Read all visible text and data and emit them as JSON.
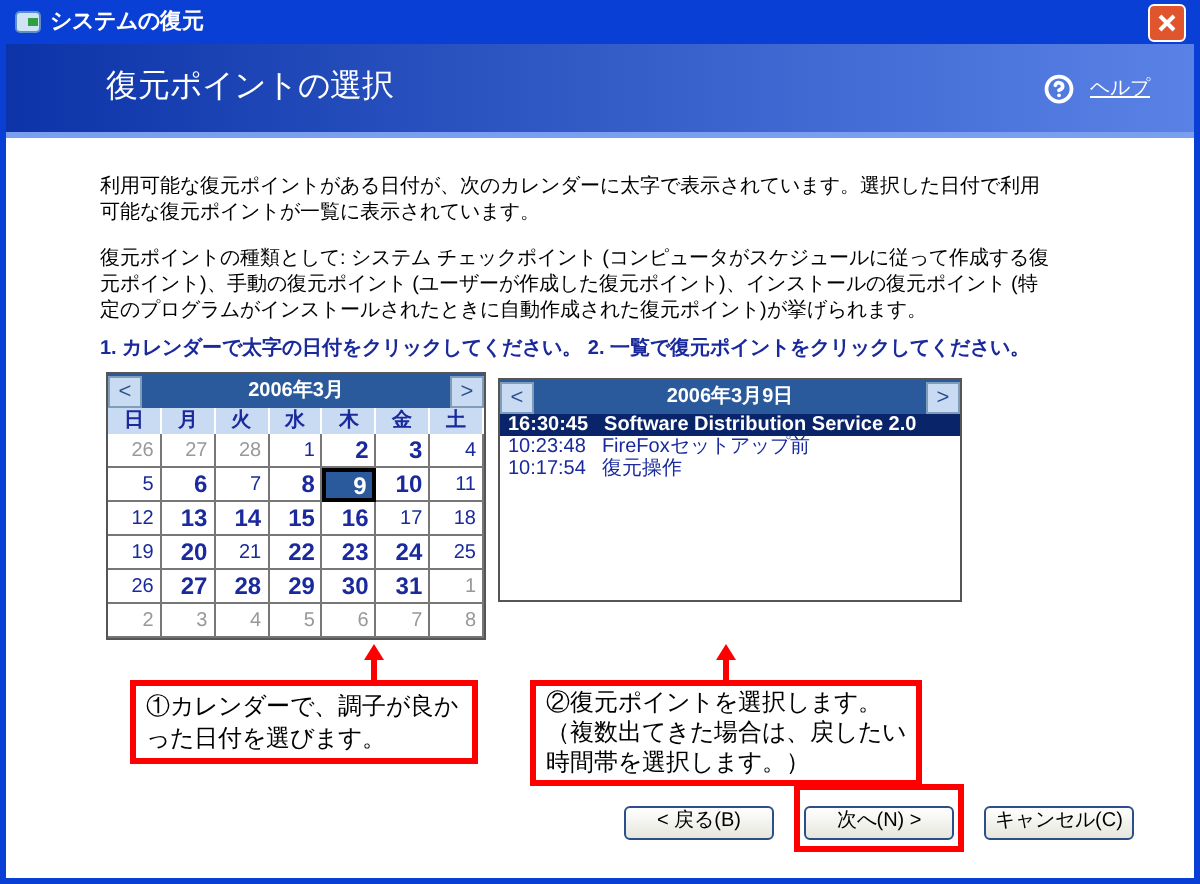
{
  "window": {
    "title": "システムの復元"
  },
  "header": {
    "title": "復元ポイントの選択",
    "help": "ヘルプ"
  },
  "intro": [
    "利用可能な復元ポイントがある日付が、次のカレンダーに太字で表示されています。選択した日付で利用可能な復元ポイントが一覧に表示されています。",
    "復元ポイントの種類として: システム チェックポイント (コンピュータがスケジュールに従って作成する復元ポイント)、手動の復元ポイント (ユーザーが作成した復元ポイント)、インストールの復元ポイント (特定のプログラムがインストールされたときに自動作成された復元ポイント)が挙げられます。"
  ],
  "instruction": "1. カレンダーで太字の日付をクリックしてください。 2. 一覧で復元ポイントをクリックしてください。",
  "calendar": {
    "prev": "<",
    "next": ">",
    "month": "2006年3月",
    "weekdays": [
      "日",
      "月",
      "火",
      "水",
      "木",
      "金",
      "土"
    ],
    "weeks": [
      [
        {
          "d": "26",
          "bold": false,
          "muted": true,
          "selected": false
        },
        {
          "d": "27",
          "bold": false,
          "muted": true,
          "selected": false
        },
        {
          "d": "28",
          "bold": false,
          "muted": true,
          "selected": false
        },
        {
          "d": "1",
          "bold": false,
          "muted": false,
          "selected": false
        },
        {
          "d": "2",
          "bold": true,
          "muted": false,
          "selected": false
        },
        {
          "d": "3",
          "bold": true,
          "muted": false,
          "selected": false
        },
        {
          "d": "4",
          "bold": false,
          "muted": false,
          "selected": false
        }
      ],
      [
        {
          "d": "5",
          "bold": false,
          "muted": false,
          "selected": false
        },
        {
          "d": "6",
          "bold": true,
          "muted": false,
          "selected": false
        },
        {
          "d": "7",
          "bold": false,
          "muted": false,
          "selected": false
        },
        {
          "d": "8",
          "bold": true,
          "muted": false,
          "selected": false
        },
        {
          "d": "9",
          "bold": true,
          "muted": false,
          "selected": true
        },
        {
          "d": "10",
          "bold": true,
          "muted": false,
          "selected": false
        },
        {
          "d": "11",
          "bold": false,
          "muted": false,
          "selected": false
        }
      ],
      [
        {
          "d": "12",
          "bold": false,
          "muted": false,
          "selected": false
        },
        {
          "d": "13",
          "bold": true,
          "muted": false,
          "selected": false
        },
        {
          "d": "14",
          "bold": true,
          "muted": false,
          "selected": false
        },
        {
          "d": "15",
          "bold": true,
          "muted": false,
          "selected": false
        },
        {
          "d": "16",
          "bold": true,
          "muted": false,
          "selected": false
        },
        {
          "d": "17",
          "bold": false,
          "muted": false,
          "selected": false
        },
        {
          "d": "18",
          "bold": false,
          "muted": false,
          "selected": false
        }
      ],
      [
        {
          "d": "19",
          "bold": false,
          "muted": false,
          "selected": false
        },
        {
          "d": "20",
          "bold": true,
          "muted": false,
          "selected": false
        },
        {
          "d": "21",
          "bold": false,
          "muted": false,
          "selected": false
        },
        {
          "d": "22",
          "bold": true,
          "muted": false,
          "selected": false
        },
        {
          "d": "23",
          "bold": true,
          "muted": false,
          "selected": false
        },
        {
          "d": "24",
          "bold": true,
          "muted": false,
          "selected": false
        },
        {
          "d": "25",
          "bold": false,
          "muted": false,
          "selected": false
        }
      ],
      [
        {
          "d": "26",
          "bold": false,
          "muted": false,
          "selected": false
        },
        {
          "d": "27",
          "bold": true,
          "muted": false,
          "selected": false
        },
        {
          "d": "28",
          "bold": true,
          "muted": false,
          "selected": false
        },
        {
          "d": "29",
          "bold": true,
          "muted": false,
          "selected": false
        },
        {
          "d": "30",
          "bold": true,
          "muted": false,
          "selected": false
        },
        {
          "d": "31",
          "bold": true,
          "muted": false,
          "selected": false
        },
        {
          "d": "1",
          "bold": false,
          "muted": true,
          "selected": false
        }
      ],
      [
        {
          "d": "2",
          "bold": false,
          "muted": true,
          "selected": false
        },
        {
          "d": "3",
          "bold": false,
          "muted": true,
          "selected": false
        },
        {
          "d": "4",
          "bold": false,
          "muted": true,
          "selected": false
        },
        {
          "d": "5",
          "bold": false,
          "muted": true,
          "selected": false
        },
        {
          "d": "6",
          "bold": false,
          "muted": true,
          "selected": false
        },
        {
          "d": "7",
          "bold": false,
          "muted": true,
          "selected": false
        },
        {
          "d": "8",
          "bold": false,
          "muted": true,
          "selected": false
        }
      ]
    ]
  },
  "restore_list": {
    "prev": "<",
    "next": ">",
    "date": "2006年3月9日",
    "items": [
      {
        "time": "16:30:45",
        "name": "Software Distribution Service 2.0",
        "selected": true
      },
      {
        "time": "10:23:48",
        "name": "FireFoxセットアップ前",
        "selected": false
      },
      {
        "time": "10:17:54",
        "name": "復元操作",
        "selected": false
      }
    ]
  },
  "callouts": [
    "①カレンダーで、調子が良かった日付を選びます。",
    "②復元ポイントを選択します。（複数出てきた場合は、戻したい時間帯を選択します。）"
  ],
  "buttons": [
    {
      "label": "< 戻る(B)",
      "highlighted": false
    },
    {
      "label": "次へ(N) >",
      "highlighted": true
    },
    {
      "label": "キャンセル(C)",
      "highlighted": false
    }
  ]
}
